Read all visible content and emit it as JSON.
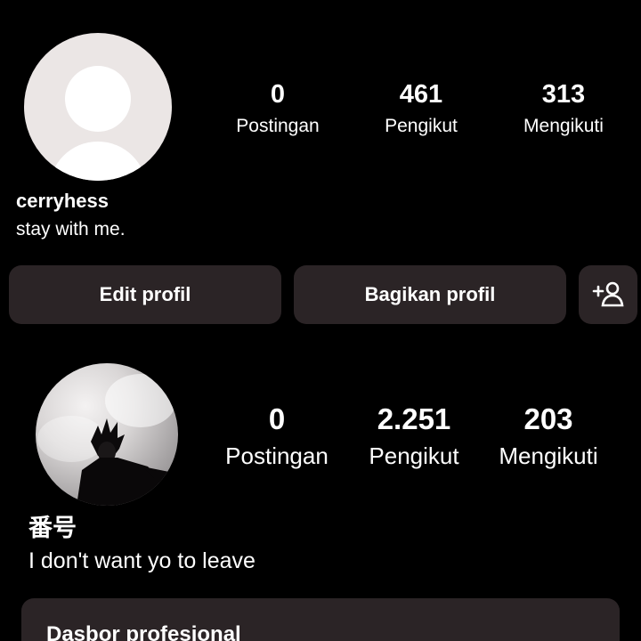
{
  "profile1": {
    "avatar_icon": "default-avatar-icon",
    "stats": {
      "posts": {
        "value": "0",
        "label": "Postingan"
      },
      "followers": {
        "value": "461",
        "label": "Pengikut"
      },
      "following": {
        "value": "313",
        "label": "Mengikuti"
      }
    },
    "username": "cerryhess",
    "bio": "stay with me.",
    "buttons": {
      "edit": "Edit profil",
      "share": "Bagikan profil",
      "add_user_icon": "add-person-icon"
    }
  },
  "profile2": {
    "avatar_icon": "profile-photo-image",
    "stats": {
      "posts": {
        "value": "0",
        "label": "Postingan"
      },
      "followers": {
        "value": "2.251",
        "label": "Pengikut"
      },
      "following": {
        "value": "203",
        "label": "Mengikuti"
      }
    },
    "username": "番号",
    "bio": "I don't want yo to leave",
    "dashboard_title": "Dasbor profesional"
  },
  "colors": {
    "background": "#000000",
    "button_bg": "#2b2426",
    "text": "#ffffff",
    "avatar_placeholder": "#ebe6e5"
  }
}
